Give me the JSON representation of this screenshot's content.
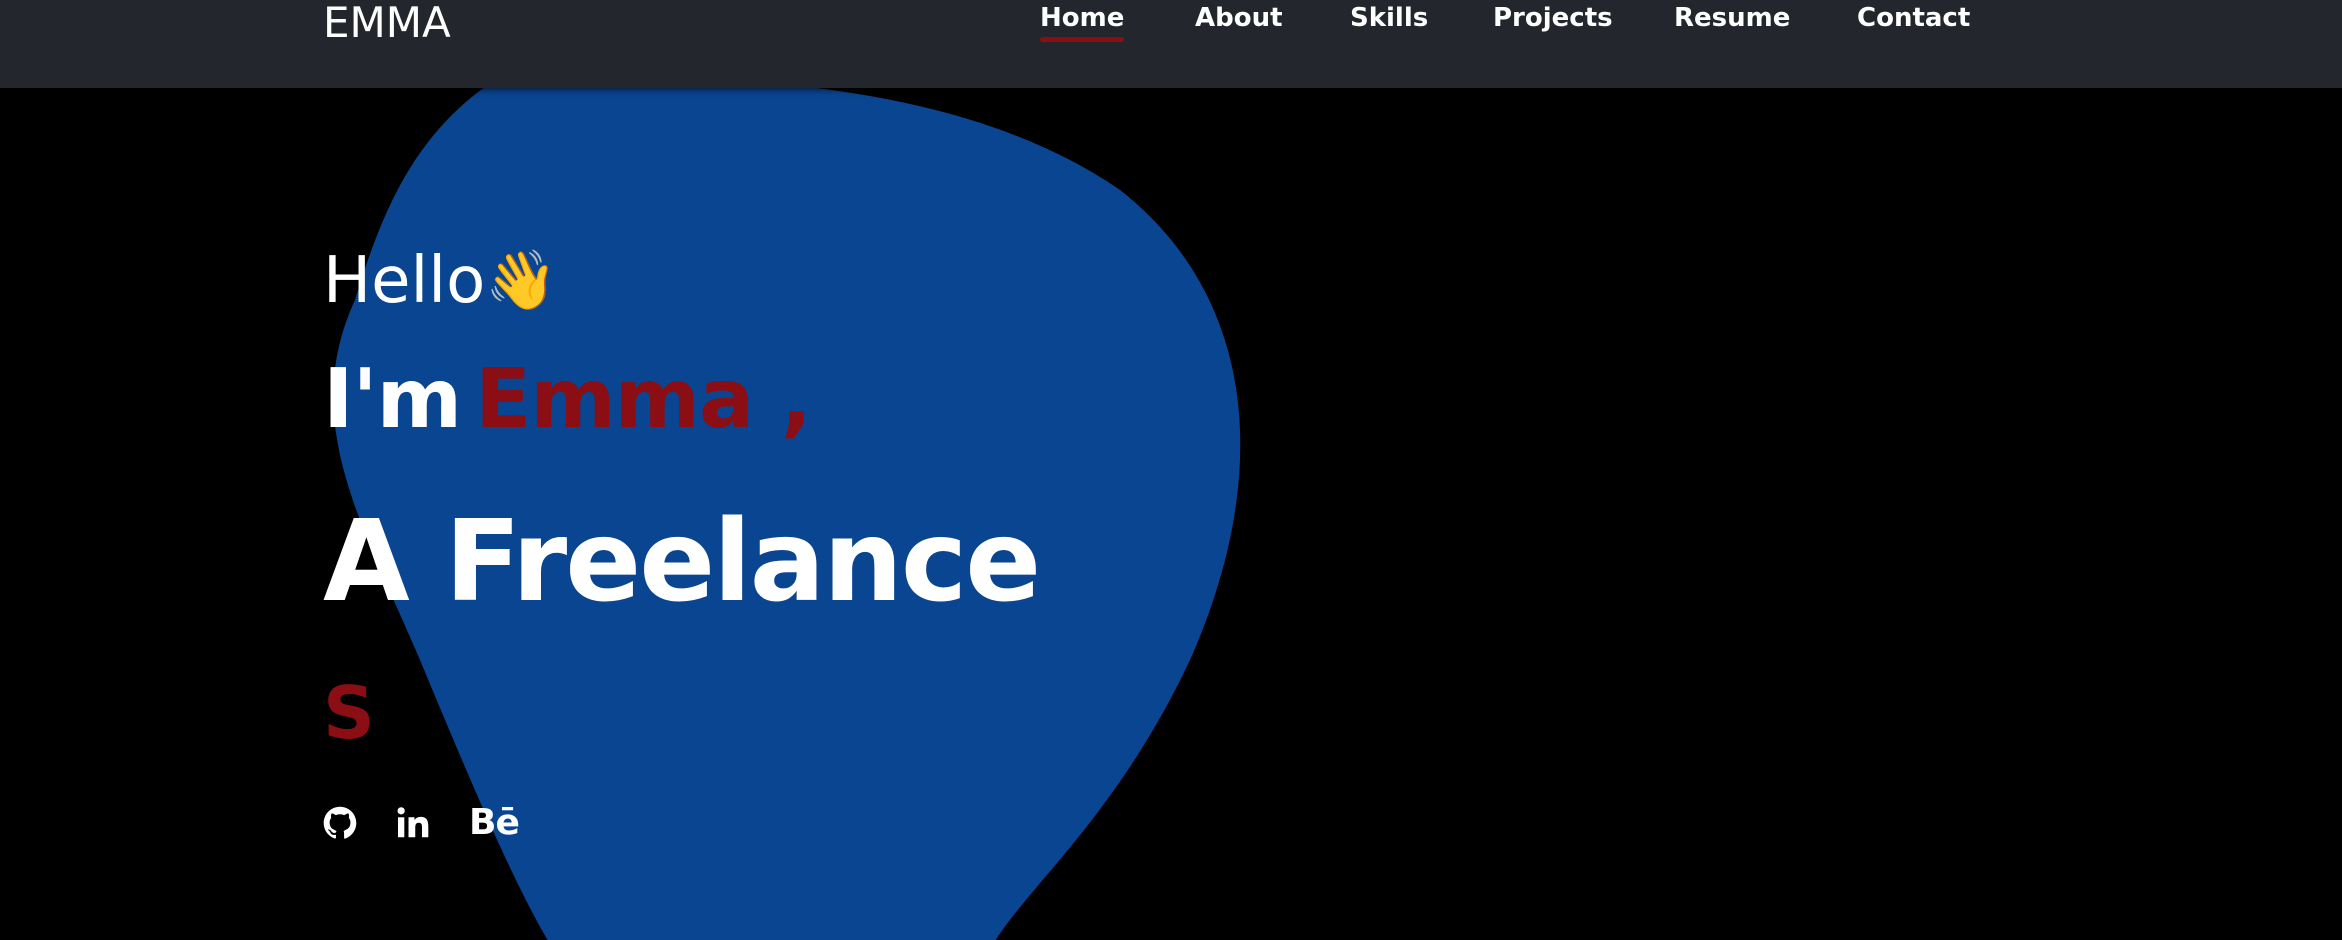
{
  "brand": {
    "name": "EMMA"
  },
  "nav": {
    "items": [
      {
        "label": "Home",
        "active": true
      },
      {
        "label": "About",
        "active": false
      },
      {
        "label": "Skills",
        "active": false
      },
      {
        "label": "Projects",
        "active": false
      },
      {
        "label": "Resume",
        "active": false
      },
      {
        "label": "Contact",
        "active": false
      }
    ]
  },
  "hero": {
    "greeting": "Hello",
    "wave_emoji": "👋",
    "intro_prefix": "I'm",
    "name": "Emma ,",
    "role": "A Freelance",
    "role_sub": "S"
  },
  "socials": {
    "items": [
      {
        "icon": "github-icon"
      },
      {
        "icon": "linkedin-icon"
      },
      {
        "icon": "behance-icon",
        "text": "Bē"
      }
    ]
  },
  "colors": {
    "background": "#000000",
    "navbar": "#23272d",
    "accent": "#8b0e14",
    "blob": "#0a4591",
    "text": "#ffffff"
  }
}
